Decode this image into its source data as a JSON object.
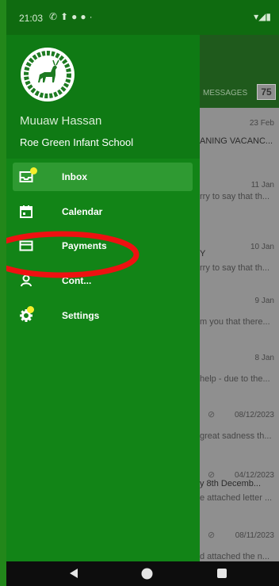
{
  "status_bar": {
    "time": "21:03"
  },
  "background_app": {
    "tab_label": "MESSAGES",
    "badge_count": "75",
    "rows": [
      {
        "date": "23 Feb",
        "title": "ANING VACANC...",
        "snippet": "",
        "attachment": false
      },
      {
        "date": "11 Jan",
        "title": "",
        "snippet": "rry to say that th...",
        "attachment": false
      },
      {
        "date": "10 Jan",
        "title": "Y",
        "snippet": "rry to say that th...",
        "attachment": false
      },
      {
        "date": "9 Jan",
        "title": "",
        "snippet": "m you that there...",
        "attachment": false
      },
      {
        "date": "8 Jan",
        "title": "",
        "snippet": " help - due to the...",
        "attachment": false
      },
      {
        "date": "08/12/2023",
        "title": "",
        "snippet": "great sadness th...",
        "attachment": true
      },
      {
        "date": "04/12/2023",
        "title": "y 8th Decemb...",
        "snippet": "e attached letter ...",
        "attachment": true
      },
      {
        "date": "08/11/2023",
        "title": "",
        "snippet": "d attached the n...",
        "attachment": true
      }
    ]
  },
  "drawer": {
    "user_name": "Muuaw Hassan",
    "school_name": "Roe Green Infant School",
    "items": [
      {
        "label": "Inbox",
        "icon": "inbox-icon",
        "active": true,
        "badge_dot": true
      },
      {
        "label": "Calendar",
        "icon": "calendar-icon",
        "active": false,
        "badge_dot": false
      },
      {
        "label": "Payments",
        "icon": "payment-card-icon",
        "active": false,
        "badge_dot": false
      },
      {
        "label": "Cont...",
        "icon": "contacts-icon",
        "active": false,
        "badge_dot": false
      },
      {
        "label": "Settings",
        "icon": "gear-icon",
        "active": false,
        "badge_dot": true
      }
    ]
  },
  "colors": {
    "drawer": "#128417",
    "drawer_header": "#0f7a14",
    "active_item": "#2f9a32",
    "notification_dot": "#f5ee2a",
    "annotation": "#ee1111"
  }
}
